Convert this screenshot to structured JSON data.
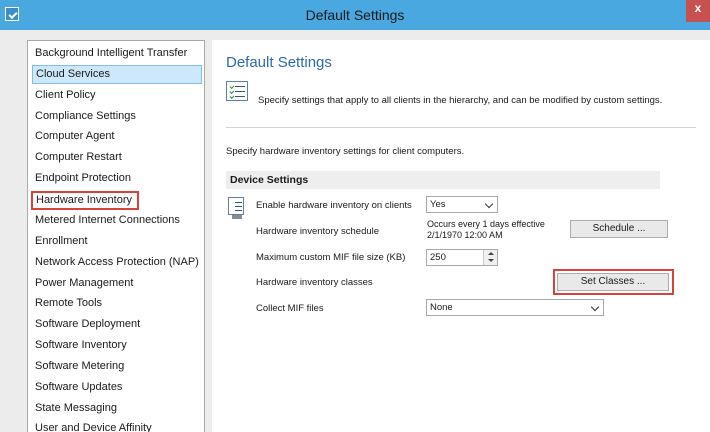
{
  "window": {
    "title": "Default Settings",
    "close_label": "x"
  },
  "sidebar": {
    "items": [
      {
        "label": "Background Intelligent Transfer"
      },
      {
        "label": "Cloud Services"
      },
      {
        "label": "Client Policy"
      },
      {
        "label": "Compliance Settings"
      },
      {
        "label": "Computer Agent"
      },
      {
        "label": "Computer Restart"
      },
      {
        "label": "Endpoint Protection"
      },
      {
        "label": "Hardware Inventory"
      },
      {
        "label": "Metered Internet Connections"
      },
      {
        "label": "Enrollment"
      },
      {
        "label": "Network Access Protection (NAP)"
      },
      {
        "label": "Power Management"
      },
      {
        "label": "Remote Tools"
      },
      {
        "label": "Software Deployment"
      },
      {
        "label": "Software Inventory"
      },
      {
        "label": "Software Metering"
      },
      {
        "label": "Software Updates"
      },
      {
        "label": "State Messaging"
      },
      {
        "label": "User and Device Affinity"
      }
    ],
    "selected": "Cloud Services",
    "highlighted": "Hardware Inventory"
  },
  "main": {
    "title": "Default Settings",
    "description": "Specify settings that apply to all clients in the hierarchy, and can be modified by custom settings.",
    "subtitle": "Specify hardware inventory settings for client computers.",
    "group_title": "Device Settings",
    "fields": {
      "enable_label": "Enable hardware inventory on clients",
      "enable_value": "Yes",
      "schedule_label": "Hardware inventory schedule",
      "schedule_line1": "Occurs every 1 days effective",
      "schedule_line2": "2/1/1970 12:00 AM",
      "schedule_button": "Schedule ...",
      "mif_size_label": "Maximum custom MIF file size (KB)",
      "mif_size_value": "250",
      "classes_label": "Hardware inventory classes",
      "classes_button": "Set Classes ...",
      "collect_label": "Collect MIF files",
      "collect_value": "None"
    }
  },
  "colors": {
    "titlebar": "#4aa8e0",
    "accent_title": "#2a6ab0",
    "selection": "#cde8fa",
    "highlight_red": "#d9413b"
  }
}
